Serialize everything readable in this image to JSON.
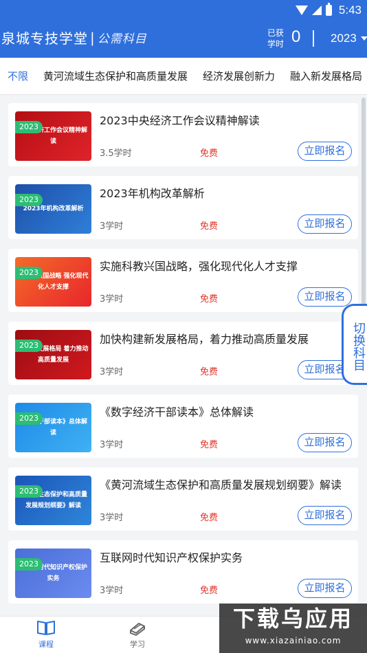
{
  "status_bar": {
    "time": "5:43"
  },
  "header": {
    "brand_name": "泉城专技学堂",
    "brand_sep": "|",
    "brand_sub": "公需科目",
    "earned_label": "已获学时",
    "earned_value": "0",
    "year": "2023"
  },
  "tabs": [
    {
      "label": "不限"
    },
    {
      "label": "黄河流域生态保护和高质量发展"
    },
    {
      "label": "经济发展创新力"
    },
    {
      "label": "融入新发展格局"
    }
  ],
  "courses": [
    {
      "badge": "2023",
      "thumb_text": "中央经济工作会议精神解读",
      "title": "2023中央经济工作会议精神解读",
      "hours": "3.5学时",
      "price": "免费",
      "button": "立即报名"
    },
    {
      "badge": "2023",
      "thumb_text": "2023年机构改革解析",
      "title": "2023年机构改革解析",
      "hours": "3学时",
      "price": "免费",
      "button": "立即报名"
    },
    {
      "badge": "2023",
      "thumb_text": "施科教兴国战略 强化现代化人才支撑",
      "title": "实施科教兴国战略，强化现代化人才支撑",
      "hours": "3学时",
      "price": "免费",
      "button": "立即报名"
    },
    {
      "badge": "2023",
      "thumb_text": "构建新发展格局 着力推动高质量发展",
      "title": "加快构建新发展格局，着力推动高质量发展",
      "hours": "3学时",
      "price": "免费",
      "button": "立即报名"
    },
    {
      "badge": "2023",
      "thumb_text": "字经济干部读本》总体解读",
      "title": "《数字经济干部读本》总体解读",
      "hours": "3学时",
      "price": "免费",
      "button": "立即报名"
    },
    {
      "badge": "2023",
      "thumb_text": "河流域生态保护和高质量发展规划纲要》解读",
      "title": "《黄河流域生态保护和高质量发展规划纲要》解读",
      "hours": "3学时",
      "price": "免费",
      "button": "立即报名"
    },
    {
      "badge": "2023",
      "thumb_text": "互联网时代知识产权保护实务",
      "title": "互联网时代知识产权保护实务",
      "hours": "3学时",
      "price": "免费",
      "button": "立即报名"
    }
  ],
  "switch_label": "切换科目",
  "bottom_nav": [
    {
      "label": "课程",
      "icon": "book-icon"
    },
    {
      "label": "学习",
      "icon": "books-stack-icon"
    }
  ],
  "watermark": {
    "main": "下载乌应用",
    "url": "www.xiazainiao.com"
  }
}
